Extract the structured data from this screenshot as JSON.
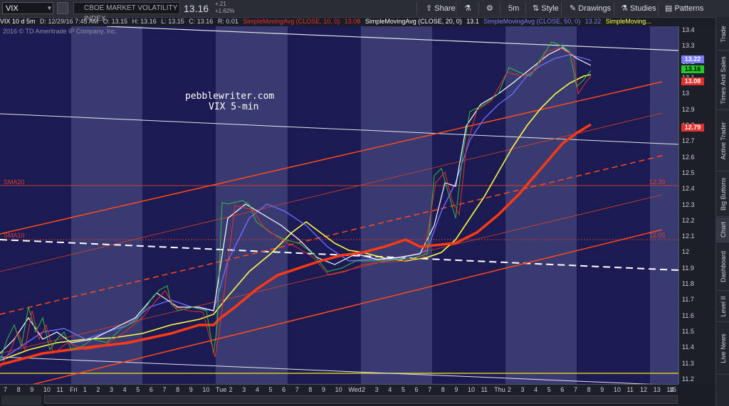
{
  "header": {
    "symbol": "VIX",
    "symbol_name": "CBOE MARKET VOLATILITY INDEX",
    "last": "13.16",
    "change": "+.21",
    "change_pct": "+1.62%",
    "toolbar": {
      "share": "Share",
      "interval": "5m",
      "style": "Style",
      "drawings": "Drawings",
      "studies": "Studies",
      "patterns": "Patterns"
    }
  },
  "info_bar": {
    "title": "VIX 10 d 5m",
    "date": "D: 12/29/16 7:45 AM",
    "open": "O: 13.15",
    "high": "H: 13.16",
    "low": "L: 13.15",
    "close": "C: 13.16",
    "change": "R: 0.01",
    "sma1": "SimpleMovingAvg (CLOSE, 10, 0)",
    "sma1_val": "13.08",
    "sma2": "SimpleMovingAvg (CLOSE, 20, 0)",
    "sma2_val": "13.1",
    "sma3": "SimpleMovingAvg (CLOSE, 50, 0)",
    "sma3_val": "13.22",
    "sma4": "SimpleMoving..."
  },
  "copyright": "2016 © TD Ameritrade IP Company, Inc.",
  "watermark": {
    "line1": "pebblewriter.com",
    "line2": "VIX 5-min"
  },
  "overlay_labels": {
    "sma20": "SMA20",
    "sma20_val": "12.39",
    "sma10": "SMA10",
    "sma10_val": "12.05"
  },
  "price_badges": [
    {
      "value": "13.22",
      "color": "#7b7bff"
    },
    {
      "value": "13.16",
      "color": "#22cc22"
    },
    {
      "value": "13.08",
      "color": "#e53030"
    },
    {
      "value": "12.79",
      "color": "#e53030"
    }
  ],
  "chart_data": {
    "type": "line",
    "y_axis": {
      "min": 11.2,
      "max": 13.4,
      "ticks": [
        "13.4",
        "13.3",
        "13.2",
        "13.1",
        "13",
        "12.9",
        "12.8",
        "12.7",
        "12.6",
        "12.5",
        "12.4",
        "12.3",
        "12.2",
        "12.1",
        "12",
        "11.9",
        "11.8",
        "11.7",
        "11.6",
        "11.5",
        "11.4",
        "11.3",
        "11.2"
      ]
    },
    "x_axis": {
      "ticks": [
        "7",
        "8",
        "9",
        "10",
        "11",
        "Fri",
        "1",
        "2",
        "3",
        "4",
        "5",
        "6",
        "7",
        "8",
        "9",
        "10",
        "Tue",
        "2",
        "3",
        "4",
        "5",
        "6",
        "7",
        "8",
        "9",
        "10",
        "Wed",
        "2",
        "3",
        "4",
        "5",
        "6",
        "7",
        "8",
        "9",
        "10",
        "11",
        "Thu",
        "2",
        "3",
        "4",
        "5",
        "6",
        "7",
        "8",
        "9",
        "10",
        "11",
        "12",
        "13",
        "14",
        "15"
      ]
    },
    "series": [
      {
        "name": "SimpleMovingAvg (CLOSE, 10, 0)",
        "color": "#ffffff"
      },
      {
        "name": "SimpleMovingAvg (CLOSE, 20, 0)",
        "color": "#6b6bff"
      },
      {
        "name": "SimpleMovingAvg (CLOSE, 50, 0)",
        "color": "#ffff44"
      }
    ]
  },
  "right_tabs": [
    "Trade",
    "Times And Sales",
    "Active Trader",
    "Big Buttons",
    "Chart",
    "Dashboard",
    "Level II",
    "Live News"
  ]
}
